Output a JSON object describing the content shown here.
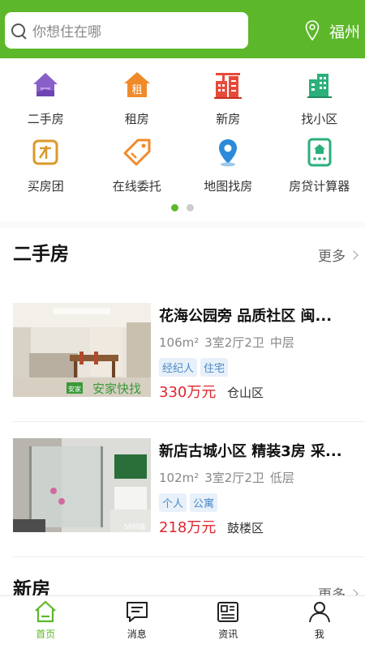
{
  "search": {
    "placeholder": "你想住在哪"
  },
  "location": {
    "city": "福州"
  },
  "menu": [
    {
      "label": "二手房",
      "icon": "house-icon",
      "color": "#8a5fc9"
    },
    {
      "label": "租房",
      "icon": "rent-icon",
      "color": "#f08a2b"
    },
    {
      "label": "新房",
      "icon": "building-crane-icon",
      "color": "#e84a3a"
    },
    {
      "label": "找小区",
      "icon": "community-icon",
      "color": "#2bb07a"
    },
    {
      "label": "买房团",
      "icon": "group-buy-icon",
      "color": "#d99a2a"
    },
    {
      "label": "在线委托",
      "icon": "tag-icon",
      "color": "#f08a2b"
    },
    {
      "label": "地图找房",
      "icon": "map-pin-icon",
      "color": "#2b8ad9"
    },
    {
      "label": "房贷计算器",
      "icon": "calculator-icon",
      "color": "#2bb07a"
    }
  ],
  "section_secondhand": {
    "title": "二手房",
    "more": "更多"
  },
  "listings": [
    {
      "title": "花海公园旁 品质社区 闽...",
      "area": "106m²",
      "layout": "3室2厅2卫",
      "floor": "中层",
      "tags": [
        "经纪人",
        "住宅"
      ],
      "price": "330万元",
      "district": "仓山区",
      "watermark": "安家快找"
    },
    {
      "title": "新店古城小区 精装3房 采...",
      "area": "102m²",
      "layout": "3室2厅2卫",
      "floor": "低层",
      "tags": [
        "个人",
        "公寓"
      ],
      "price": "218万元",
      "district": "鼓楼区",
      "watermark": "58同城"
    }
  ],
  "section_new": {
    "title": "新房",
    "more": "更多"
  },
  "tabs": [
    {
      "label": "首页",
      "icon": "home-icon",
      "active": true
    },
    {
      "label": "消息",
      "icon": "message-icon",
      "active": false
    },
    {
      "label": "资讯",
      "icon": "news-icon",
      "active": false
    },
    {
      "label": "我",
      "icon": "profile-icon",
      "active": false
    }
  ],
  "colors": {
    "brand": "#5cb82a",
    "price": "#e0262e",
    "tag_text": "#4a8ac7"
  }
}
